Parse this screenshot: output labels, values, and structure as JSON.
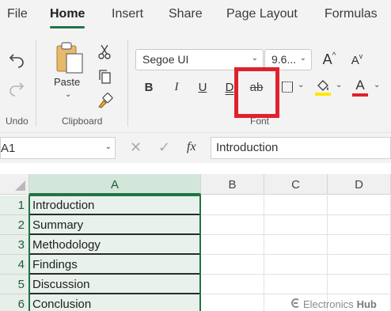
{
  "menu": {
    "tabs": [
      "File",
      "Home",
      "Insert",
      "Share",
      "Page Layout",
      "Formulas"
    ],
    "active": "Home",
    "accent": "#217346"
  },
  "ribbon": {
    "undo_group_label": "Undo",
    "clipboard": {
      "paste_label": "Paste",
      "group_label": "Clipboard"
    },
    "font": {
      "family": "Segoe UI",
      "size": "9.6...",
      "group_label": "Font",
      "bold": "B",
      "italic": "I",
      "underline": "U",
      "double_underline": "D",
      "strikethrough": "ab",
      "font_color_glyph": "A",
      "grow_glyph": "A",
      "shrink_glyph": "A",
      "highlight_color": "#ffe600",
      "font_color": "#e0212b"
    },
    "callout_color": "#e0212b"
  },
  "formula_bar": {
    "name_box": "A1",
    "fx": "fx",
    "value": "Introduction"
  },
  "sheet": {
    "columns": [
      "A",
      "B",
      "C",
      "D"
    ],
    "rows": [
      {
        "num": "1",
        "a": "Introduction"
      },
      {
        "num": "2",
        "a": "Summary"
      },
      {
        "num": "3",
        "a": "Methodology"
      },
      {
        "num": "4",
        "a": "Findings"
      },
      {
        "num": "5",
        "a": "Discussion"
      },
      {
        "num": "6",
        "a": "Conclusion"
      }
    ]
  },
  "watermark": {
    "text": "Electronics",
    "brand": "Hub"
  }
}
